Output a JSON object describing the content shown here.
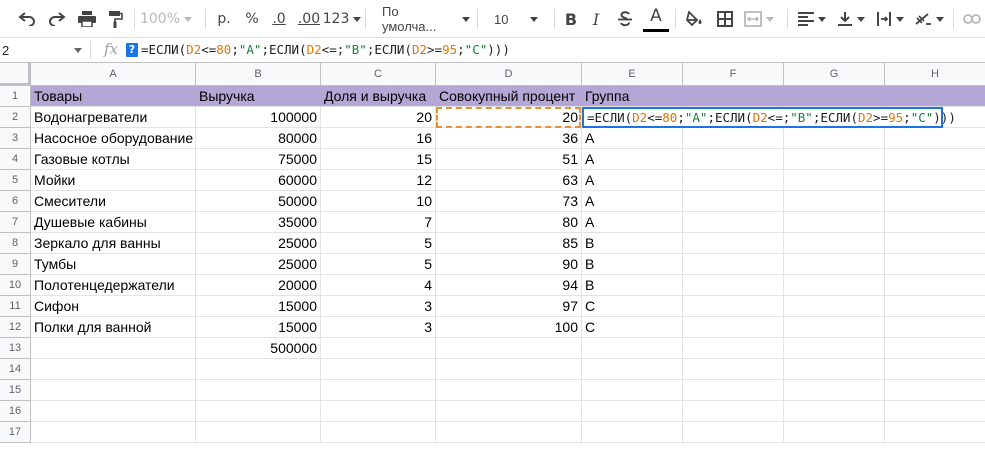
{
  "toolbar": {
    "zoom": "100%",
    "currency": "р.",
    "percent": "%",
    "dec_decrease": ".0",
    "dec_increase": ".00",
    "more_formats": "123",
    "font": "По умолча...",
    "font_size": "10",
    "bold": "B",
    "italic": "I",
    "text_color": "A",
    "colors": {
      "accent": "#1a73e8",
      "text_color_bar": "#000000"
    }
  },
  "formula_bar": {
    "cell_ref": "2",
    "fx_label": "fx",
    "help": "?",
    "formula_parts": {
      "p0": "=ЕСЛИ(",
      "p1": "D2",
      "p2": "<=",
      "p3": "80",
      "p4": ";",
      "p5": "\"A\"",
      "p6": ";ЕСЛИ(",
      "p7": "D2",
      "p8": "<=;",
      "p9": "\"B\"",
      "p10": ";ЕСЛИ(",
      "p11": "D2",
      "p12": ">=",
      "p13": "95",
      "p14": ";",
      "p15": "\"C\"",
      "p16": ")))"
    }
  },
  "grid": {
    "columns": [
      "A",
      "B",
      "C",
      "D",
      "E",
      "F",
      "G",
      "H"
    ],
    "rows": [
      "1",
      "2",
      "3",
      "4",
      "5",
      "6",
      "7",
      "8",
      "9",
      "10",
      "11",
      "12",
      "13",
      "14",
      "15",
      "16",
      "17"
    ],
    "header_color": "#b4a7d6",
    "header_row": [
      "Товары",
      "Выручка",
      "Доля и выручка",
      "Совокупный процент",
      "Группа"
    ],
    "data": [
      [
        "Водонагреватели",
        "100000",
        "20",
        "20",
        ""
      ],
      [
        "Насосное оборудование",
        "80000",
        "16",
        "36",
        "A"
      ],
      [
        "Газовые котлы",
        "75000",
        "15",
        "51",
        "A"
      ],
      [
        "Мойки",
        "60000",
        "12",
        "63",
        "A"
      ],
      [
        "Смесители",
        "50000",
        "10",
        "73",
        "A"
      ],
      [
        "Душевые кабины",
        "35000",
        "7",
        "80",
        "A"
      ],
      [
        "Зеркало для ванны",
        "25000",
        "5",
        "85",
        "B"
      ],
      [
        "Тумбы",
        "25000",
        "5",
        "90",
        "B"
      ],
      [
        "Полотенцедержатели",
        "20000",
        "4",
        "94",
        "B"
      ],
      [
        "Сифон",
        "15000",
        "3",
        "97",
        "C"
      ],
      [
        "Полки для ванной",
        "15000",
        "3",
        "100",
        "C"
      ],
      [
        "",
        "500000",
        "",
        "",
        ""
      ]
    ]
  }
}
